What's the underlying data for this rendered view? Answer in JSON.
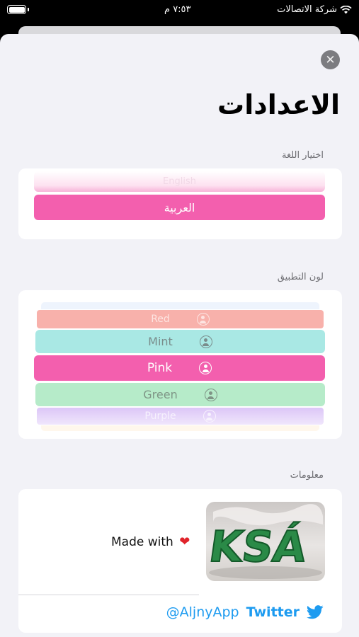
{
  "status_bar": {
    "carrier": "شركة الاتصالات",
    "time": "٧:٥٣ م"
  },
  "page": {
    "title": "الاعدادات"
  },
  "language_section": {
    "label": "اختيار اللغة",
    "options": [
      "English",
      "العربية"
    ],
    "selected": "العربية"
  },
  "color_section": {
    "label": "لون التطبيق",
    "options": [
      {
        "name": "Red",
        "color": "#f8b1ab"
      },
      {
        "name": "Mint",
        "color": "#a9e8e4"
      },
      {
        "name": "Pink",
        "color": "#f35fae"
      },
      {
        "name": "Green",
        "color": "#b6ebc9"
      },
      {
        "name": "Purple",
        "color": "#dcc6f7"
      }
    ],
    "selected": "Pink"
  },
  "info_section": {
    "label": "معلومات",
    "made_with": "Made with",
    "image_text": "KSÁ",
    "social": {
      "network": "Twitter",
      "handle": "@AljnyApp"
    }
  },
  "colors": {
    "accent": "#f35fae",
    "twitter": "#1d9bf0",
    "background": "#f2f2f7"
  }
}
